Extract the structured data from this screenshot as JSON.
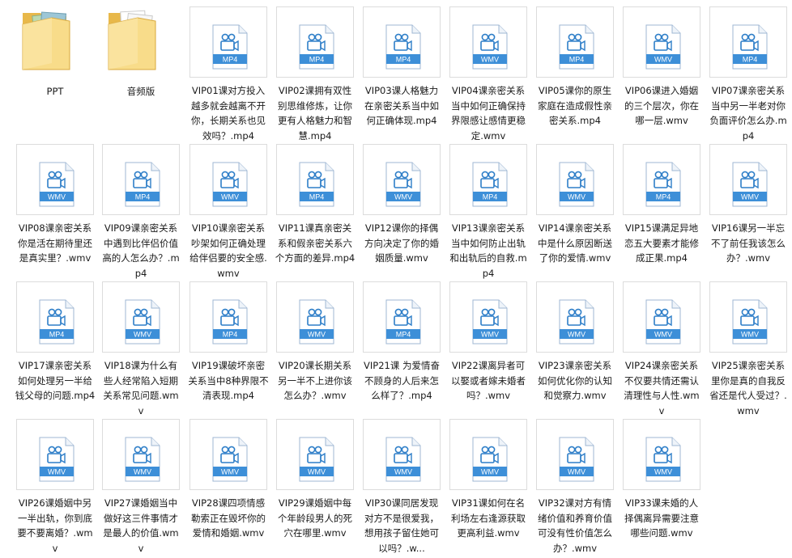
{
  "window": {
    "view": "large-icons"
  },
  "colors": {
    "folder_light": "#f8dc8a",
    "folder_dark": "#e8b84a",
    "file_icon_bg": "#ffffff",
    "file_icon_border": "#9fb7d3",
    "file_banner": "#3d8fd8",
    "file_glyph": "#2e7ec8"
  },
  "items": [
    {
      "type": "folder",
      "name": "PPT",
      "icon": "folder-with-documents-icon",
      "variant": "documents"
    },
    {
      "type": "folder",
      "name": "音频版",
      "icon": "folder-icon",
      "variant": "papers"
    },
    {
      "type": "file",
      "ext": "MP4",
      "name": "VIP01课对方投入越多就会越离不开你，长期关系也见效吗？.mp4",
      "icon": "video-file-icon"
    },
    {
      "type": "file",
      "ext": "MP4",
      "name": "VIP02课拥有双性别思维修炼，让你更有人格魅力和智慧.mp4",
      "icon": "video-file-icon"
    },
    {
      "type": "file",
      "ext": "MP4",
      "name": "VIP03课人格魅力在亲密关系当中如何正确体现.mp4",
      "icon": "video-file-icon"
    },
    {
      "type": "file",
      "ext": "WMV",
      "name": "VIP04课亲密关系当中如何正确保持界限感让感情更稳定.wmv",
      "icon": "video-file-icon"
    },
    {
      "type": "file",
      "ext": "MP4",
      "name": "VIP05课你的原生家庭在造成假性亲密关系.mp4",
      "icon": "video-file-icon"
    },
    {
      "type": "file",
      "ext": "WMV",
      "name": "VIP06课进入婚姻的三个层次，你在哪一层.wmv",
      "icon": "video-file-icon"
    },
    {
      "type": "file",
      "ext": "MP4",
      "name": "VIP07课亲密关系当中另一半老对你负面评价怎么办.mp4",
      "icon": "video-file-icon"
    },
    {
      "type": "file",
      "ext": "WMV",
      "name": "VIP08课亲密关系你是活在期待里还是真实里？.wmv",
      "icon": "video-file-icon"
    },
    {
      "type": "file",
      "ext": "MP4",
      "name": "VIP09课亲密关系中遇到比伴侣价值高的人怎么办？.mp4",
      "icon": "video-file-icon"
    },
    {
      "type": "file",
      "ext": "WMV",
      "name": "VIP10课亲密关系吵架如何正确处理给伴侣要的安全感.wmv",
      "icon": "video-file-icon"
    },
    {
      "type": "file",
      "ext": "MP4",
      "name": "VIP11课真亲密关系和假亲密关系六个方面的差异.mp4",
      "icon": "video-file-icon"
    },
    {
      "type": "file",
      "ext": "WMV",
      "name": "VIP12课你的择偶方向决定了你的婚姻质量.wmv",
      "icon": "video-file-icon"
    },
    {
      "type": "file",
      "ext": "MP4",
      "name": "VIP13课亲密关系当中如何防止出轨和出轨后的自救.mp4",
      "icon": "video-file-icon"
    },
    {
      "type": "file",
      "ext": "WMV",
      "name": "VIP14课亲密关系中是什么原因断送了你的爱情.wmv",
      "icon": "video-file-icon"
    },
    {
      "type": "file",
      "ext": "MP4",
      "name": "VIP15课满足异地恋五大要素才能修成正果.mp4",
      "icon": "video-file-icon"
    },
    {
      "type": "file",
      "ext": "WMV",
      "name": "VIP16课另一半忘不了前任我该怎么办？.wmv",
      "icon": "video-file-icon"
    },
    {
      "type": "file",
      "ext": "MP4",
      "name": "VIP17课亲密关系如何处理另一半给钱父母的问题.mp4",
      "icon": "video-file-icon"
    },
    {
      "type": "file",
      "ext": "WMV",
      "name": "VIP18课为什么有些人经常陷入短期关系常见问题.wmv",
      "icon": "video-file-icon"
    },
    {
      "type": "file",
      "ext": "MP4",
      "name": "VIP19课破坏亲密关系当中8种界限不清表现.mp4",
      "icon": "video-file-icon"
    },
    {
      "type": "file",
      "ext": "WMV",
      "name": "VIP20课长期关系另一半不上进你该怎么办？.wmv",
      "icon": "video-file-icon"
    },
    {
      "type": "file",
      "ext": "MP4",
      "name": "VIP21课 为爱情奋不顾身的人后来怎么样了？.mp4",
      "icon": "video-file-icon"
    },
    {
      "type": "file",
      "ext": "WMV",
      "name": "VIP22课离异者可以娶或者嫁未婚者吗？.wmv",
      "icon": "video-file-icon"
    },
    {
      "type": "file",
      "ext": "WMV",
      "name": "VIP23课亲密关系如何优化你的认知和觉察力.wmv",
      "icon": "video-file-icon"
    },
    {
      "type": "file",
      "ext": "WMV",
      "name": "VIP24课亲密关系不仅要共情还需认清理性与人性.wmv",
      "icon": "video-file-icon"
    },
    {
      "type": "file",
      "ext": "WMV",
      "name": "VIP25课亲密关系里你是真的自我反省还是代人受过？.wmv",
      "icon": "video-file-icon"
    },
    {
      "type": "file",
      "ext": "WMV",
      "name": "VIP26课婚姻中另一半出轨，你到底要不要离婚？.wmv",
      "icon": "video-file-icon"
    },
    {
      "type": "file",
      "ext": "WMV",
      "name": "VIP27课婚姻当中做好这三件事情才是最人的价值.wmv",
      "icon": "video-file-icon"
    },
    {
      "type": "file",
      "ext": "WMV",
      "name": "VIP28课四项情感勒索正在毁坏你的爱情和婚姻.wmv",
      "icon": "video-file-icon"
    },
    {
      "type": "file",
      "ext": "WMV",
      "name": "VIP29课婚姻中每个年龄段男人的死穴在哪里.wmv",
      "icon": "video-file-icon"
    },
    {
      "type": "file",
      "ext": "WMV",
      "name": "VIP30课同居发现对方不是很爱我，想用孩子留住她可以吗？.w...",
      "icon": "video-file-icon"
    },
    {
      "type": "file",
      "ext": "WMV",
      "name": "VIP31课如何在名利场左右逢源获取更高利益.wmv",
      "icon": "video-file-icon"
    },
    {
      "type": "file",
      "ext": "WMV",
      "name": "VIP32课对方有情绪价值和养育价值可没有性价值怎么办？.wmv",
      "icon": "video-file-icon"
    },
    {
      "type": "file",
      "ext": "WMV",
      "name": "VIP33课未婚的人择偶离异需要注意哪些问题.wmv",
      "icon": "video-file-icon"
    }
  ]
}
